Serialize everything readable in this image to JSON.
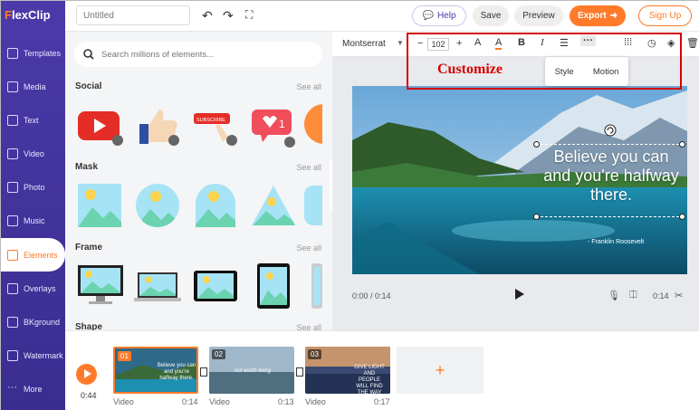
{
  "app": {
    "logo_f": "F",
    "logo_rest": "lexClip"
  },
  "nav": {
    "items": [
      {
        "label": "Templates",
        "icon": "templates-icon"
      },
      {
        "label": "Media",
        "icon": "media-icon"
      },
      {
        "label": "Text",
        "icon": "text-icon"
      },
      {
        "label": "Video",
        "icon": "video-icon"
      },
      {
        "label": "Photo",
        "icon": "photo-icon"
      },
      {
        "label": "Music",
        "icon": "music-icon"
      },
      {
        "label": "Elements",
        "icon": "elements-icon"
      },
      {
        "label": "Overlays",
        "icon": "overlays-icon"
      },
      {
        "label": "BKground",
        "icon": "background-icon"
      },
      {
        "label": "Watermark",
        "icon": "watermark-icon"
      },
      {
        "label": "More",
        "icon": "more-icon"
      }
    ],
    "active": "Elements"
  },
  "topbar": {
    "title_placeholder": "Untitled",
    "help": "Help",
    "save": "Save",
    "preview": "Preview",
    "export": "Export",
    "signup": "Sign Up"
  },
  "panel": {
    "search_placeholder": "Search millions of elements...",
    "sections": [
      {
        "title": "Social",
        "see_all": "See all"
      },
      {
        "title": "Mask",
        "see_all": "See all"
      },
      {
        "title": "Frame",
        "see_all": "See all"
      },
      {
        "title": "Shape",
        "see_all": "See all"
      }
    ],
    "social_like_count": "1",
    "subscribe_label": "SUBSCRIBE"
  },
  "toolbar": {
    "font": "Montserrat",
    "font_size": "102",
    "minus": "−",
    "plus": "+",
    "bold": "B",
    "italic": "I",
    "more": "···"
  },
  "annotation": {
    "label": "Customize"
  },
  "style_menu": {
    "style": "Style",
    "motion": "Motion"
  },
  "canvas": {
    "quote": "Believe you can and you're halfway there.",
    "author": "- Franklin Roosevelt"
  },
  "playback": {
    "time": "0:00 / 0:14",
    "duration": "0:14"
  },
  "timeline": {
    "total": "0:44",
    "clips": [
      {
        "num": "01",
        "label": "Video",
        "duration": "0:14",
        "text": "Believe you can and you're halfway there."
      },
      {
        "num": "02",
        "label": "Video",
        "duration": "0:13",
        "text": "not worth living"
      },
      {
        "num": "03",
        "label": "Video",
        "duration": "0:17",
        "text": "GIVE LIGHT AND PEOPLE WILL FIND THE WAY"
      }
    ],
    "add": "+"
  },
  "colors": {
    "brand": "#4b3aa8",
    "accent": "#ff7a29",
    "annotation": "#d40000"
  }
}
